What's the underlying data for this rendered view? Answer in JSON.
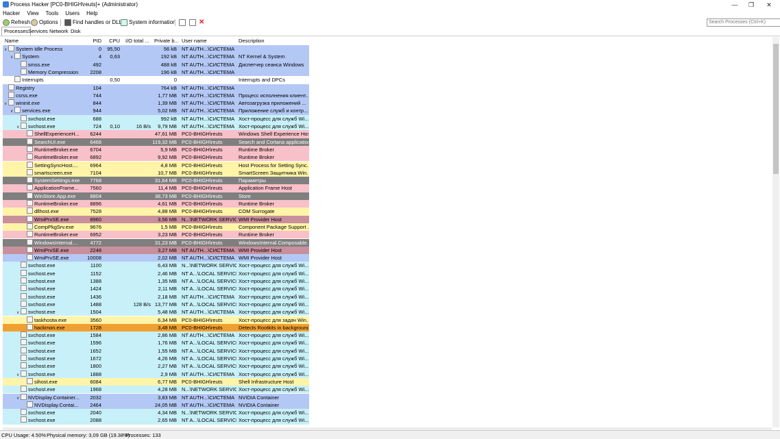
{
  "window": {
    "title": "Process Hacker [PC0-BHIGH\\reuts]+ (Administrator)",
    "minimize": "—",
    "maximize": "❐",
    "close": "✕"
  },
  "menu": [
    "Hacker",
    "View",
    "Tools",
    "Users",
    "Help"
  ],
  "toolbar": {
    "refresh": "Refresh",
    "options": "Options",
    "find": "Find handles or DLLs",
    "sysinfo": "System information",
    "search_placeholder": "Search Processes (Ctrl+K)"
  },
  "tabs": [
    "Processes",
    "Services",
    "Network",
    "Disk"
  ],
  "columns": [
    "Name",
    "PID",
    "CPU",
    "I/O total ...",
    "Private b...",
    "User name",
    "Description"
  ],
  "rows": [
    {
      "d": 0,
      "e": "v",
      "n": "System Idle Process",
      "pid": "0",
      "cpu": "95,50",
      "io": "",
      "pb": "56 kB",
      "u": "NT AUTH...\\СИСТЕМА",
      "desc": "",
      "bg": "#b4c8f5"
    },
    {
      "d": 1,
      "e": "v",
      "n": "System",
      "pid": "4",
      "cpu": "0,63",
      "io": "",
      "pb": "192 kB",
      "u": "NT AUTH...\\СИСТЕМА",
      "desc": "NT Kernel & System",
      "bg": "#b4c8f5"
    },
    {
      "d": 2,
      "e": "",
      "n": "smss.exe",
      "pid": "492",
      "cpu": "",
      "io": "",
      "pb": "488 kB",
      "u": "NT AUTH...\\СИСТЕМА",
      "desc": "Диспетчер сеанса  Windows",
      "bg": "#b4c8f5"
    },
    {
      "d": 2,
      "e": "",
      "n": "Memory Compression",
      "pid": "2208",
      "cpu": "",
      "io": "",
      "pb": "196 kB",
      "u": "NT AUTH...\\СИСТЕМА",
      "desc": "",
      "bg": "#b4c8f5"
    },
    {
      "d": 1,
      "e": "",
      "n": "Interrupts",
      "pid": "",
      "cpu": "0,50",
      "io": "",
      "pb": "0",
      "u": "",
      "desc": "Interrupts and DPCs",
      "bg": "#ffffff"
    },
    {
      "d": 0,
      "e": "",
      "n": "Registry",
      "pid": "104",
      "cpu": "",
      "io": "",
      "pb": "764 kB",
      "u": "NT AUTH...\\СИСТЕМА",
      "desc": "",
      "bg": "#b4c8f5"
    },
    {
      "d": 0,
      "e": "",
      "n": "csrss.exe",
      "pid": "744",
      "cpu": "",
      "io": "",
      "pb": "1,77 MB",
      "u": "NT AUTH...\\СИСТЕМА",
      "desc": "Процесс исполнения клиент...",
      "bg": "#b4c8f5"
    },
    {
      "d": 0,
      "e": "v",
      "n": "wininit.exe",
      "pid": "844",
      "cpu": "",
      "io": "",
      "pb": "1,39 MB",
      "u": "NT AUTH...\\СИСТЕМА",
      "desc": "Автозагрузка приложений ...",
      "bg": "#b4c8f5"
    },
    {
      "d": 1,
      "e": "v",
      "n": "services.exe",
      "pid": "944",
      "cpu": "",
      "io": "",
      "pb": "5,02 MB",
      "u": "NT AUTH...\\СИСТЕМА",
      "desc": "Приложение служб и контр...",
      "bg": "#b4c8f5"
    },
    {
      "d": 2,
      "e": "",
      "n": "svchost.exe",
      "pid": "688",
      "cpu": "",
      "io": "",
      "pb": "992 kB",
      "u": "NT AUTH...\\СИСТЕМА",
      "desc": "Хост-процесс для служб Wi...",
      "bg": "#c8f0f8"
    },
    {
      "d": 2,
      "e": "v",
      "n": "svchost.exe",
      "pid": "724",
      "cpu": "0,10",
      "io": "16 B/s",
      "pb": "9,79 MB",
      "u": "NT AUTH...\\СИСТЕМА",
      "desc": "Хост-процесс для служб Wi...",
      "bg": "#c8f0f8"
    },
    {
      "d": 3,
      "e": "",
      "n": "ShellExperienceH...",
      "pid": "6244",
      "cpu": "",
      "io": "",
      "pb": "47,61 MB",
      "u": "PC0-BHIGH\\reuts",
      "desc": "Windows Shell Experience Host",
      "bg": "#f8c0c8"
    },
    {
      "d": 3,
      "e": "",
      "n": "SearchUI.exe",
      "pid": "6468",
      "cpu": "",
      "io": "",
      "pb": "119,32 MB",
      "u": "PC0-BHIGH\\reuts",
      "desc": "Search and Cortana application",
      "bg": "#7f7f7f"
    },
    {
      "d": 3,
      "e": "",
      "n": "RuntimeBroker.exe",
      "pid": "6704",
      "cpu": "",
      "io": "",
      "pb": "5,9 MB",
      "u": "PC0-BHIGH\\reuts",
      "desc": "Runtime Broker",
      "bg": "#f8c0c8"
    },
    {
      "d": 3,
      "e": "",
      "n": "RuntimeBroker.exe",
      "pid": "6892",
      "cpu": "",
      "io": "",
      "pb": "9,92 MB",
      "u": "PC0-BHIGH\\reuts",
      "desc": "Runtime Broker",
      "bg": "#f8c0c8"
    },
    {
      "d": 3,
      "e": "",
      "n": "SettingSyncHost....",
      "pid": "6964",
      "cpu": "",
      "io": "",
      "pb": "4,8 MB",
      "u": "PC0-BHIGH\\reuts",
      "desc": "Host Process for Setting Sync...",
      "bg": "#fff4a8"
    },
    {
      "d": 3,
      "e": "",
      "n": "smartscreen.exe",
      "pid": "7104",
      "cpu": "",
      "io": "",
      "pb": "10,7 MB",
      "u": "PC0-BHIGH\\reuts",
      "desc": "SmartScreen Защитника Win...",
      "bg": "#fff4a8"
    },
    {
      "d": 3,
      "e": "",
      "n": "SystemSettings.exe",
      "pid": "7768",
      "cpu": "",
      "io": "",
      "pb": "31,64 MB",
      "u": "PC0-BHIGH\\reuts",
      "desc": "Параметры",
      "bg": "#7f7f7f"
    },
    {
      "d": 3,
      "e": "",
      "n": "ApplicationFrame...",
      "pid": "7560",
      "cpu": "",
      "io": "",
      "pb": "11,4 MB",
      "u": "PC0-BHIGH\\reuts",
      "desc": "Application Frame Host",
      "bg": "#f8c0c8"
    },
    {
      "d": 3,
      "e": "",
      "n": "WinStore.App.exe",
      "pid": "8804",
      "cpu": "",
      "io": "",
      "pb": "38,73 MB",
      "u": "PC0-BHIGH\\reuts",
      "desc": "Store",
      "bg": "#7f7f7f"
    },
    {
      "d": 3,
      "e": "",
      "n": "RuntimeBroker.exe",
      "pid": "8896",
      "cpu": "",
      "io": "",
      "pb": "4,61 MB",
      "u": "PC0-BHIGH\\reuts",
      "desc": "Runtime Broker",
      "bg": "#f8c0c8"
    },
    {
      "d": 3,
      "e": "",
      "n": "dllhost.exe",
      "pid": "7528",
      "cpu": "",
      "io": "",
      "pb": "4,88 MB",
      "u": "PC0-BHIGH\\reuts",
      "desc": "COM Surrogate",
      "bg": "#fff4a8"
    },
    {
      "d": 3,
      "e": "",
      "n": "WmiPrvSE.exe",
      "pid": "8960",
      "cpu": "",
      "io": "",
      "pb": "3,56 MB",
      "u": "N...\\NETWORK SERVICE",
      "desc": "WMI Provider Host",
      "bg": "#c8909c"
    },
    {
      "d": 3,
      "e": "",
      "n": "CompPkgSrv.exe",
      "pid": "9676",
      "cpu": "",
      "io": "",
      "pb": "1,5 MB",
      "u": "PC0-BHIGH\\reuts",
      "desc": "Component Package Support ...",
      "bg": "#fff4a8"
    },
    {
      "d": 3,
      "e": "",
      "n": "RuntimeBroker.exe",
      "pid": "6952",
      "cpu": "",
      "io": "",
      "pb": "3,23 MB",
      "u": "PC0-BHIGH\\reuts",
      "desc": "Runtime Broker",
      "bg": "#f8c0c8"
    },
    {
      "d": 3,
      "e": "",
      "n": "WindowsInternal....",
      "pid": "4772",
      "cpu": "",
      "io": "",
      "pb": "31,23 MB",
      "u": "PC0-BHIGH\\reuts",
      "desc": "WindowsInternal.Composable...",
      "bg": "#7f7f7f"
    },
    {
      "d": 3,
      "e": "",
      "n": "WmiPrvSE.exe",
      "pid": "2248",
      "cpu": "",
      "io": "",
      "pb": "3,27 MB",
      "u": "NT AUTH...\\СИСТЕМА",
      "desc": "WMI Provider Host",
      "bg": "#c8909c"
    },
    {
      "d": 3,
      "e": "",
      "n": "WmiPrvSE.exe",
      "pid": "10008",
      "cpu": "",
      "io": "",
      "pb": "2,02 MB",
      "u": "NT AUTH...\\СИСТЕМА",
      "desc": "WMI Provider Host",
      "bg": "#b4c8f5"
    },
    {
      "d": 2,
      "e": "",
      "n": "svchost.exe",
      "pid": "1100",
      "cpu": "",
      "io": "",
      "pb": "6,43 MB",
      "u": "N...\\NETWORK SERVICE",
      "desc": "Хост-процесс для служб Wi...",
      "bg": "#c8f0f8"
    },
    {
      "d": 2,
      "e": "",
      "n": "svchost.exe",
      "pid": "1152",
      "cpu": "",
      "io": "",
      "pb": "2,46 MB",
      "u": "NT A...\\LOCAL SERVICE",
      "desc": "Хост-процесс для служб Wi...",
      "bg": "#c8f0f8"
    },
    {
      "d": 2,
      "e": "",
      "n": "svchost.exe",
      "pid": "1388",
      "cpu": "",
      "io": "",
      "pb": "1,35 MB",
      "u": "NT A...\\LOCAL SERVICE",
      "desc": "Хост-процесс для служб Wi...",
      "bg": "#c8f0f8"
    },
    {
      "d": 2,
      "e": "",
      "n": "svchost.exe",
      "pid": "1424",
      "cpu": "",
      "io": "",
      "pb": "2,11 MB",
      "u": "NT A...\\LOCAL SERVICE",
      "desc": "Хост-процесс для служб Wi...",
      "bg": "#c8f0f8"
    },
    {
      "d": 2,
      "e": "",
      "n": "svchost.exe",
      "pid": "1436",
      "cpu": "",
      "io": "",
      "pb": "2,18 MB",
      "u": "NT AUTH...\\СИСТЕМА",
      "desc": "Хост-процесс для служб Wi...",
      "bg": "#c8f0f8"
    },
    {
      "d": 2,
      "e": "",
      "n": "svchost.exe",
      "pid": "1488",
      "cpu": "",
      "io": "128 B/s",
      "pb": "13,77 MB",
      "u": "NT A...\\LOCAL SERVICE",
      "desc": "Хост-процесс для служб Wi...",
      "bg": "#c8f0f8"
    },
    {
      "d": 2,
      "e": "v",
      "n": "svchost.exe",
      "pid": "1504",
      "cpu": "",
      "io": "",
      "pb": "5,48 MB",
      "u": "NT AUTH...\\СИСТЕМА",
      "desc": "Хост-процесс для служб Wi...",
      "bg": "#c8f0f8"
    },
    {
      "d": 3,
      "e": "",
      "n": "taskhostw.exe",
      "pid": "3560",
      "cpu": "",
      "io": "",
      "pb": "6,34 MB",
      "u": "PC0-BHIGH\\reuts",
      "desc": "Хост-процесс для задач Win...",
      "bg": "#fff4a8"
    },
    {
      "d": 3,
      "e": "",
      "n": "hackmon.exe",
      "pid": "1728",
      "cpu": "",
      "io": "",
      "pb": "3,48 MB",
      "u": "PC0-BHIGH\\reuts",
      "desc": "Detects Rootkits in background",
      "bg": "#f0a030"
    },
    {
      "d": 2,
      "e": "",
      "n": "svchost.exe",
      "pid": "1584",
      "cpu": "",
      "io": "",
      "pb": "2,86 MB",
      "u": "NT AUTH...\\СИСТЕМА",
      "desc": "Хост-процесс для служб Wi...",
      "bg": "#c8f0f8"
    },
    {
      "d": 2,
      "e": "",
      "n": "svchost.exe",
      "pid": "1596",
      "cpu": "",
      "io": "",
      "pb": "1,76 MB",
      "u": "NT A...\\LOCAL SERVICE",
      "desc": "Хост-процесс для служб Wi...",
      "bg": "#c8f0f8"
    },
    {
      "d": 2,
      "e": "",
      "n": "svchost.exe",
      "pid": "1652",
      "cpu": "",
      "io": "",
      "pb": "1,55 MB",
      "u": "NT A...\\LOCAL SERVICE",
      "desc": "Хост-процесс для служб Wi...",
      "bg": "#c8f0f8"
    },
    {
      "d": 2,
      "e": "",
      "n": "svchost.exe",
      "pid": "1672",
      "cpu": "",
      "io": "",
      "pb": "4,26 MB",
      "u": "NT A...\\LOCAL SERVICE",
      "desc": "Хост-процесс для служб Wi...",
      "bg": "#c8f0f8"
    },
    {
      "d": 2,
      "e": "",
      "n": "svchost.exe",
      "pid": "1800",
      "cpu": "",
      "io": "",
      "pb": "2,27 MB",
      "u": "NT A...\\LOCAL SERVICE",
      "desc": "Хост-процесс для служб Wi...",
      "bg": "#c8f0f8"
    },
    {
      "d": 2,
      "e": "v",
      "n": "svchost.exe",
      "pid": "1888",
      "cpu": "",
      "io": "",
      "pb": "2,9 MB",
      "u": "NT AUTH...\\СИСТЕМА",
      "desc": "Хост-процесс для служб Wi...",
      "bg": "#c8f0f8"
    },
    {
      "d": 3,
      "e": "",
      "n": "sihost.exe",
      "pid": "6084",
      "cpu": "",
      "io": "",
      "pb": "6,77 MB",
      "u": "PC0-BHIGH\\reuts",
      "desc": "Shell Infrastructure Host",
      "bg": "#fff4a8"
    },
    {
      "d": 2,
      "e": "",
      "n": "svchost.exe",
      "pid": "1968",
      "cpu": "",
      "io": "",
      "pb": "4,28 MB",
      "u": "N...\\NETWORK SERVICE",
      "desc": "Хост-процесс для служб Wi...",
      "bg": "#c8f0f8"
    },
    {
      "d": 2,
      "e": "v",
      "n": "NVDisplay.Container...",
      "pid": "2032",
      "cpu": "",
      "io": "",
      "pb": "3,83 MB",
      "u": "NT AUTH...\\СИСТЕМА",
      "desc": "NVIDIA Container",
      "bg": "#b4c8f5"
    },
    {
      "d": 3,
      "e": "",
      "n": "NVDisplay.Contai...",
      "pid": "2464",
      "cpu": "",
      "io": "",
      "pb": "24,05 MB",
      "u": "NT AUTH...\\СИСТЕМА",
      "desc": "NVIDIA Container",
      "bg": "#b4c8f5"
    },
    {
      "d": 2,
      "e": "",
      "n": "svchost.exe",
      "pid": "2040",
      "cpu": "",
      "io": "",
      "pb": "4,34 MB",
      "u": "N...\\NETWORK SERVICE",
      "desc": "Хост-процесс для служб Wi...",
      "bg": "#c8f0f8"
    },
    {
      "d": 2,
      "e": "",
      "n": "svchost.exe",
      "pid": "2088",
      "cpu": "",
      "io": "",
      "pb": "2,65 MB",
      "u": "NT A...\\LOCAL SERVICE",
      "desc": "Хост-процесс для служб Wi...",
      "bg": "#c8f0f8"
    }
  ],
  "status": {
    "cpu": "CPU Usage: 4.50%",
    "memory": "Physical memory: 3,09 GB (19.38%)",
    "processes": "Processes: 133"
  }
}
